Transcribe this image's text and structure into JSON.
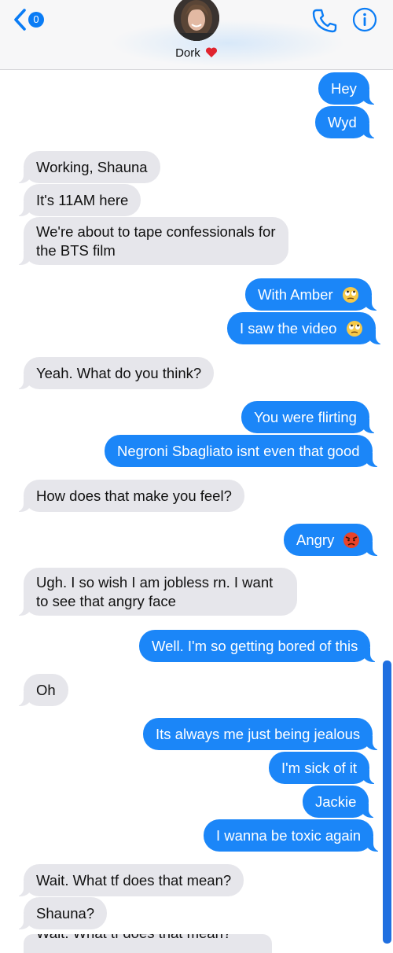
{
  "header": {
    "badge_count": "0",
    "contact_name": "Dork",
    "contact_emoji": "❤️"
  },
  "messages": [
    {
      "side": "out",
      "text": "Hey"
    },
    {
      "side": "out",
      "text": "Wyd"
    },
    {
      "side": "in",
      "text": "Working, Shauna"
    },
    {
      "side": "in",
      "text": "It's 11AM here"
    },
    {
      "side": "in",
      "text": "We're about to tape confessionals for the BTS film"
    },
    {
      "side": "out",
      "text": "With Amber",
      "emoji": "eye-roll"
    },
    {
      "side": "out",
      "text": "I saw the video",
      "emoji": "eye-roll"
    },
    {
      "side": "in",
      "text": "Yeah. What do you think?"
    },
    {
      "side": "out",
      "text": "You were flirting"
    },
    {
      "side": "out",
      "text": "Negroni Sbagliato isnt even that good"
    },
    {
      "side": "in",
      "text": "How does that make you feel?"
    },
    {
      "side": "out",
      "text": "Angry",
      "emoji": "angry-face"
    },
    {
      "side": "in",
      "text": "Ugh. I so wish I am jobless rn. I want to see that angry face"
    },
    {
      "side": "out",
      "text": "Well. I'm so getting bored of this"
    },
    {
      "side": "in",
      "text": "Oh"
    },
    {
      "side": "out",
      "text": "Its always me just being jealous"
    },
    {
      "side": "out",
      "text": "I'm sick of it"
    },
    {
      "side": "out",
      "text": "Jackie"
    },
    {
      "side": "out",
      "text": "I wanna be toxic again"
    },
    {
      "side": "in",
      "text": "Wait. What tf does that mean?"
    },
    {
      "side": "in",
      "text": "Shauna?"
    },
    {
      "side": "in",
      "text": "Wait. What tf does that mean?"
    }
  ],
  "colors": {
    "outgoing_bubble": "#1b86f8",
    "incoming_bubble": "#e6e6eb",
    "accent": "#0a7cf5"
  },
  "icons": [
    "back-chevron-icon",
    "phone-icon",
    "info-icon",
    "eye-roll-emoji-icon",
    "angry-face-emoji-icon",
    "heart-icon"
  ]
}
